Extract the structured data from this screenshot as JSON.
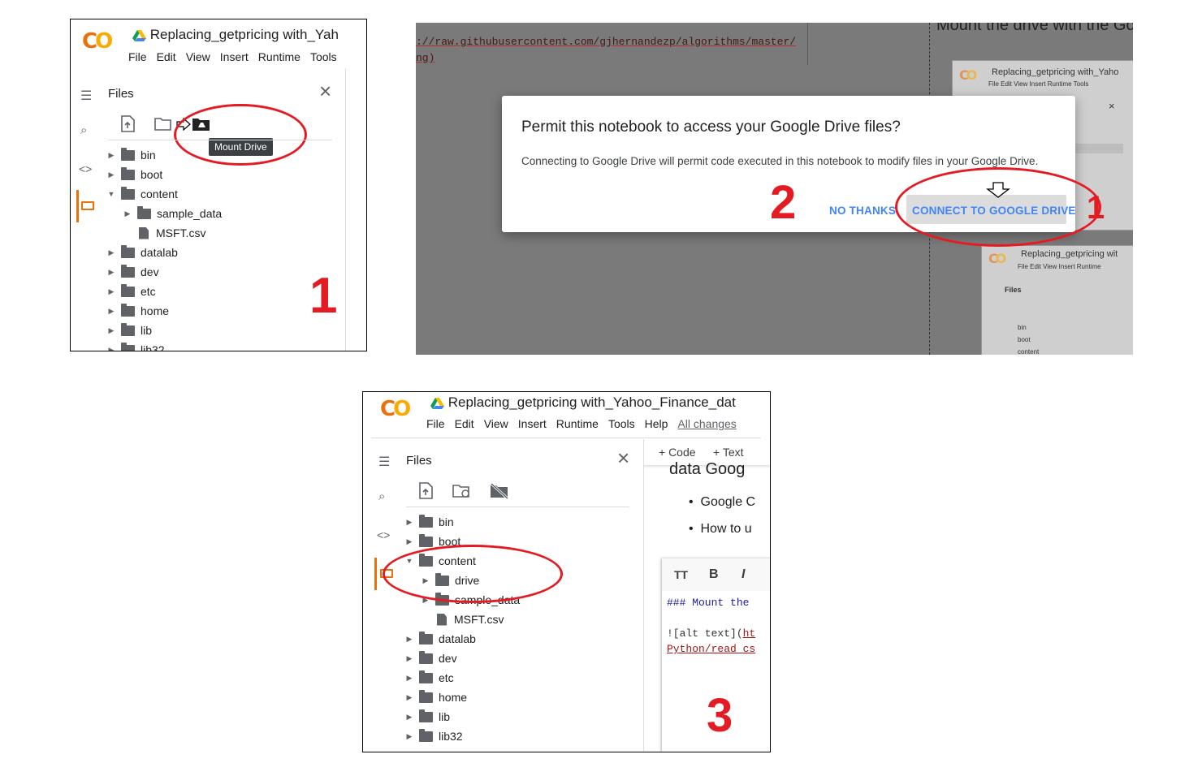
{
  "step1": {
    "app_title": "Replacing_getpricing with_Yah",
    "menu": [
      "File",
      "Edit",
      "View",
      "Insert",
      "Runtime",
      "Tools"
    ],
    "files_title": "Files",
    "tooltip": "Mount Drive",
    "tree": [
      {
        "label": "bin",
        "type": "folder",
        "expand": "collapsed"
      },
      {
        "label": "boot",
        "type": "folder",
        "expand": "collapsed"
      },
      {
        "label": "content",
        "type": "folder",
        "expand": "expanded"
      },
      {
        "label": "sample_data",
        "type": "folder",
        "expand": "collapsed"
      },
      {
        "label": "MSFT.csv",
        "type": "file",
        "expand": "none"
      },
      {
        "label": "datalab",
        "type": "folder",
        "expand": "collapsed"
      },
      {
        "label": "dev",
        "type": "folder",
        "expand": "collapsed"
      },
      {
        "label": "etc",
        "type": "folder",
        "expand": "collapsed"
      },
      {
        "label": "home",
        "type": "folder",
        "expand": "collapsed"
      },
      {
        "label": "lib",
        "type": "folder",
        "expand": "collapsed"
      },
      {
        "label": "lib32",
        "type": "folder",
        "expand": "collapsed"
      }
    ],
    "step_number": "1"
  },
  "step2": {
    "code_line1": "://raw.githubusercontent.com/gjhernandezp/algorithms/master/",
    "code_line2": "ng)",
    "heading": "Mount the drive with the Go",
    "dialog_title": "Permit this notebook to access your Google Drive files?",
    "dialog_body": "Connecting to Google Drive will permit code executed in this notebook to modify files in your Google Drive.",
    "no_thanks": "NO THANKS",
    "connect": "CONNECT TO GOOGLE DRIVE",
    "step_number": "2",
    "partial_number": "1",
    "mini_title": "Replacing_getpricing with_Yaho",
    "mini_menu": "File  Edit  View  Insert  Runtime  Tools",
    "mini_title2": "Replacing_getpricing wit",
    "mini_menu2": "File  Edit  View  Insert  Runtime",
    "mini_files": "Files",
    "mini_tree": [
      "bin",
      "boot",
      "content"
    ]
  },
  "step3": {
    "app_title": "Replacing_getpricing with_Yahoo_Finance_dat",
    "menu": [
      "File",
      "Edit",
      "View",
      "Insert",
      "Runtime",
      "Tools",
      "Help"
    ],
    "all_changes": "All changes",
    "files_title": "Files",
    "add_code": "+ Code",
    "add_text": "+ Text",
    "nb_heading": "data Goog",
    "bullets": [
      "Google C",
      "How to u"
    ],
    "editor_tools": [
      "TT",
      "B",
      "I"
    ],
    "code_line1": "### Mount the",
    "code_line2_a": "![alt text](",
    "code_line2_b": "ht",
    "code_line3": "Python/read_cs",
    "tree": [
      {
        "label": "bin",
        "type": "folder",
        "expand": "collapsed"
      },
      {
        "label": "boot",
        "type": "folder",
        "expand": "collapsed"
      },
      {
        "label": "content",
        "type": "folder",
        "expand": "expanded"
      },
      {
        "label": "drive",
        "type": "folder",
        "expand": "collapsed"
      },
      {
        "label": "sample_data",
        "type": "folder",
        "expand": "collapsed"
      },
      {
        "label": "MSFT.csv",
        "type": "file",
        "expand": "none"
      },
      {
        "label": "datalab",
        "type": "folder",
        "expand": "collapsed"
      },
      {
        "label": "dev",
        "type": "folder",
        "expand": "collapsed"
      },
      {
        "label": "etc",
        "type": "folder",
        "expand": "collapsed"
      },
      {
        "label": "home",
        "type": "folder",
        "expand": "collapsed"
      },
      {
        "label": "lib",
        "type": "folder",
        "expand": "collapsed"
      },
      {
        "label": "lib32",
        "type": "folder",
        "expand": "collapsed"
      }
    ],
    "step_number": "3"
  },
  "colors": {
    "accent": "#e8710a",
    "annotation_red": "#e51b23",
    "link_blue": "#4285f4",
    "overlay_gray": "#7a7a7a"
  },
  "icons": {
    "logo": "colab-logo-icon",
    "drive": "google-drive-icon",
    "toc": "table-of-contents-icon",
    "search": "search-icon",
    "code": "code-snippets-icon",
    "files": "folder-icon",
    "upload": "upload-icon",
    "refresh": "refresh-icon",
    "mount": "mount-drive-icon",
    "close": "close-icon"
  }
}
